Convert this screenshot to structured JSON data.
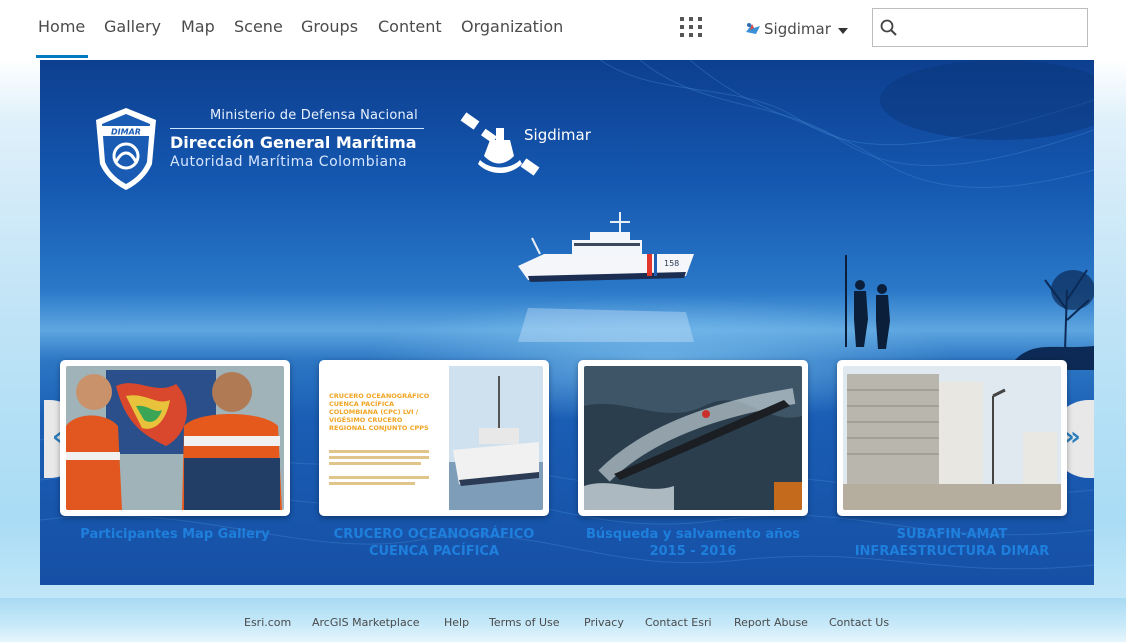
{
  "nav": {
    "items": [
      {
        "label": "Home"
      },
      {
        "label": "Gallery"
      },
      {
        "label": "Map"
      },
      {
        "label": "Scene"
      },
      {
        "label": "Groups"
      },
      {
        "label": "Content"
      },
      {
        "label": "Organization"
      }
    ],
    "active": "Home",
    "user_name": "Sigdimar",
    "search_placeholder": ""
  },
  "hero": {
    "ministry": "Ministerio de Defensa Nacional",
    "direccion": "Dirección General Marítima",
    "autoridad": "Autoridad Marítima Colombiana",
    "dimar_logo_text": "DIMAR",
    "sigdimar_logo_text": "Sigdimar",
    "ship_number": "158"
  },
  "carousel": {
    "cards": [
      {
        "title": "Participantes Map Gallery"
      },
      {
        "title": "CRUCERO OCEANOGRÁFICO CUENCA PACÍFICA",
        "thumb_heading": "CRUCERO OCEANOGRÁFICO CUENCA PACÍFICA COLOMBIANA (CPC) LVI / VIGÉSIMO CRUCERO REGIONAL CONJUNTO CPPS"
      },
      {
        "title": "Búsqueda y salvamento años 2015 - 2016"
      },
      {
        "title": "SUBAFIN-AMAT INFRAESTRUCTURA DIMAR"
      }
    ],
    "prev_glyph": "«",
    "next_glyph": "»"
  },
  "footer": {
    "links": [
      {
        "label": "Esri.com"
      },
      {
        "label": "ArcGIS Marketplace"
      },
      {
        "label": "Help"
      },
      {
        "label": "Terms of Use"
      },
      {
        "label": "Privacy"
      },
      {
        "label": "Contact Esri"
      },
      {
        "label": "Report Abuse"
      },
      {
        "label": "Contact Us"
      }
    ]
  },
  "colors": {
    "accent": "#0079c1",
    "card_title": "#1f7fdd",
    "hero_top": "#0d3f8f",
    "coast_guard_stripe": "#e2372b"
  },
  "icons": {
    "apps": "apps-grid-icon",
    "search": "search-icon",
    "user": "user-avatar-icon"
  }
}
